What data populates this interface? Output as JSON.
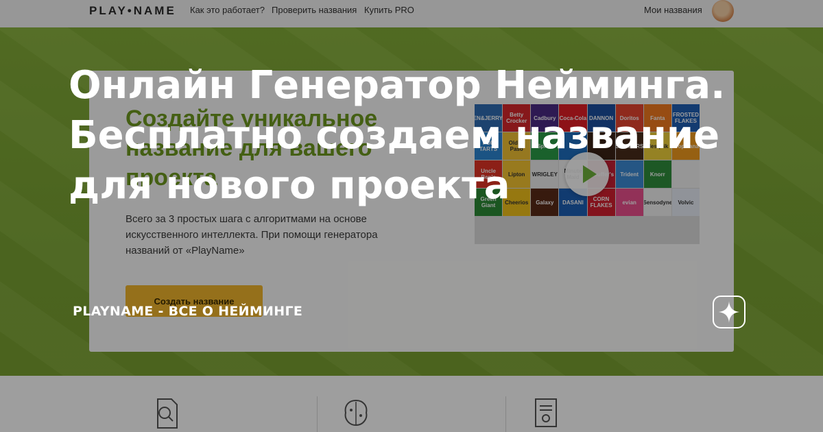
{
  "site": {
    "logo": "PLAY•NAME",
    "nav": [
      "Как это работает?",
      "Проверить названия",
      "Купить PRO"
    ],
    "my_names": "Мои названия"
  },
  "card": {
    "title": "Создайте уникальное название для вашего проекта",
    "text": "Всего за 3 простых шага с алгоритмами на основе искусственного интеллекта. При помощи генератора названий от «PlayName»",
    "button": "Создать название",
    "logos": [
      {
        "label": "BEN&JERRY'S",
        "color": "#2f6db3"
      },
      {
        "label": "Betty Crocker",
        "color": "#d8282c"
      },
      {
        "label": "Cadbury",
        "color": "#4b2a85"
      },
      {
        "label": "Coca-Cola",
        "color": "#e41e26"
      },
      {
        "label": "DANNON",
        "color": "#1c4fa0"
      },
      {
        "label": "Doritos",
        "color": "#e7442f"
      },
      {
        "label": "Fanta",
        "color": "#f47b20"
      },
      {
        "label": "FROSTED FLAKES",
        "color": "#1f5fb5"
      },
      {
        "label": "POP TARTS",
        "color": "#2d86d3"
      },
      {
        "label": "Old El Paso",
        "color": "#f3c235"
      },
      {
        "label": "Sprite",
        "color": "#2a9d48"
      },
      {
        "label": "",
        "color": "#1d6fc0"
      },
      {
        "label": "",
        "color": "#3a2215"
      },
      {
        "label": "SNICKERS",
        "color": "#4a2c1b"
      },
      {
        "label": "Nesquik",
        "color": "#f1d23a"
      },
      {
        "label": "Tropicana",
        "color": "#f29c1d"
      },
      {
        "label": "Uncle Ben's",
        "color": "#e23426"
      },
      {
        "label": "Lipton",
        "color": "#f6c531"
      },
      {
        "label": "WRIGLEY",
        "color": "#eeeeee"
      },
      {
        "label": "Minute Maid",
        "color": "#f3f3f3"
      },
      {
        "label": "Stouffer's",
        "color": "#c81f34"
      },
      {
        "label": "Trident",
        "color": "#3c8cd6"
      },
      {
        "label": "Knorr",
        "color": "#2f8f3d"
      },
      {
        "label": "",
        "color": "#f3f3f3"
      },
      {
        "label": "Green Giant",
        "color": "#2c8c36"
      },
      {
        "label": "Cheerios",
        "color": "#f2c21a"
      },
      {
        "label": "Galaxy",
        "color": "#5a2a18"
      },
      {
        "label": "DASANI",
        "color": "#1c5fb5"
      },
      {
        "label": "CORN FLAKES",
        "color": "#d4202f"
      },
      {
        "label": "evian",
        "color": "#ec4f8f"
      },
      {
        "label": "Sensodyne",
        "color": "#f2f2f2"
      },
      {
        "label": "Volvic",
        "color": "#e8eef7"
      }
    ]
  },
  "overlay": {
    "headline": [
      "Онлайн Генератор Нейминга.",
      "Бесплатно создаем название",
      "для нового проекта"
    ],
    "channel": "PLAYNAME - ВСЕ О НЕЙМИНГЕ"
  }
}
